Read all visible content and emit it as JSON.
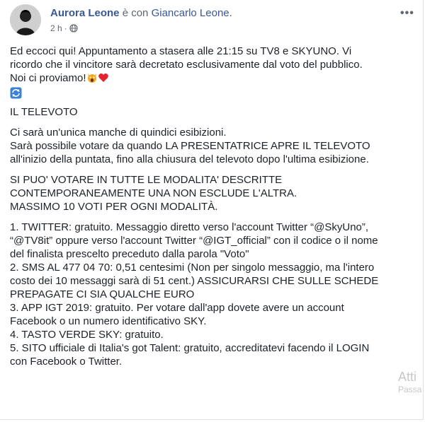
{
  "post": {
    "author": "Aurora Leone",
    "with_text": "è con",
    "tagged": "Giancarlo Leone.",
    "time": "2 h",
    "privacy_icon": "globe-icon",
    "more_icon": "more-options-icon"
  },
  "body": {
    "intro1": "Ed eccoci qui! Appuntamento a stasera alle 21:15 su TV8 e SKYUNO. Vi",
    "intro2": "ricordo che il vincitore sarà decretato esclusivamente dal voto del pubblico.",
    "intro3": "Noi ci proviamo!",
    "emoji_icons": [
      "scream-cat-emoji-icon",
      "red-heart-emoji-icon",
      "repeat-arrows-emoji-icon"
    ],
    "section_title": "IL TELEVOTO",
    "p1_l1": "Ci sarà un'unica manche di quindici esibizioni.",
    "p1_l2": "Sarà possibile votare da quando LA PRESENTATRICE APRE IL TELEVOTO",
    "p1_l3": "all'inizio della puntata, fino alla chiusura del televoto dopo l'ultima esibizione.",
    "p2_l1": "SI PUO' VOTARE IN TUTTE LE MODALITA' DESCRITTE",
    "p2_l2": "CONTEMPORANEAMENTE UNA NON ESCLUDE L'ALTRA.",
    "p2_l3": "MASSIMO 10 VOTI PER OGNI MODALITÀ.",
    "i1_l1": "1. TWITTER: gratuito. Messaggio diretto verso l'account Twitter “@SkyUno”,",
    "i1_l2": "“@TV8it” oppure verso l'account Twitter “@IGT_official” con il codice o il nome",
    "i1_l3": "del finalista prescelto preceduto dalla parola \"Voto\"",
    "i2_l1": "2. SMS AL 477 04 70: 0,51 centesimi (Non per singolo messaggio, ma l'intero",
    "i2_l2": "costo dei 10 messaggi sarà di 51 cent.) ASSICURARSI CHE SULLE SCHEDE",
    "i2_l3": "PREPAGATE CI SIA QUALCHE EURO",
    "i3_l1": "3. APP IGT 2019: gratuito. Per votare dall'app dovete avere un account",
    "i3_l2": "Facebook o un numero identificativo SKY.",
    "i4_l1": "4. TASTO VERDE SKY: gratuito.",
    "i5_l1": "5. SITO ufficiale di Italia's got Talent: gratuito, accreditatevi facendo il LOGIN",
    "i5_l2": "con Facebook o Twitter."
  },
  "overlay": {
    "line1": "Atti",
    "line2": "Passa"
  }
}
